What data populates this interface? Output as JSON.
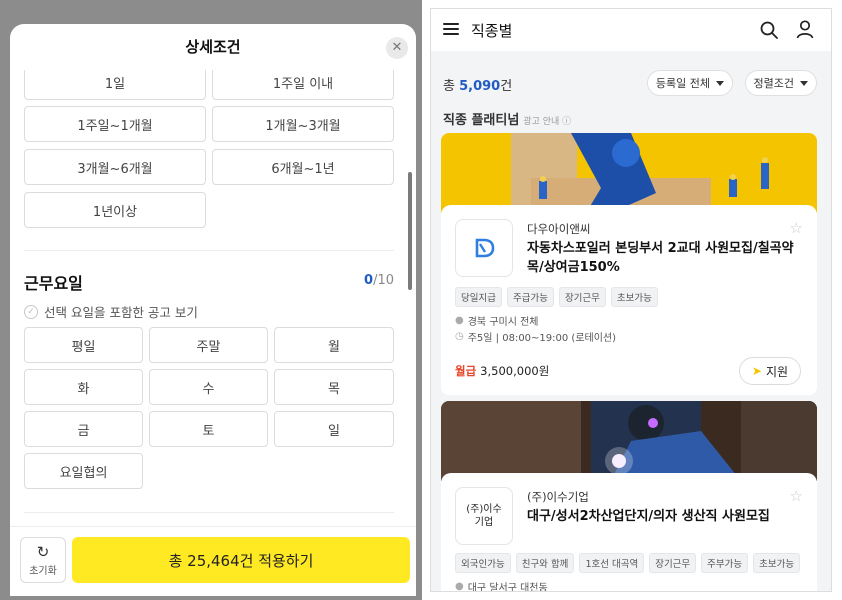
{
  "left": {
    "title": "상세조건",
    "close_icon": "close-icon",
    "period_options": [
      "1일",
      "1주일 이내",
      "1주일~1개월",
      "1개월~3개월",
      "3개월~6개월",
      "6개월~1년",
      "1년이상"
    ],
    "workday": {
      "title": "근무요일",
      "count_current": "0",
      "count_total": "/10",
      "check_label": "선택 요일을 포함한 공고 보기",
      "options": [
        "평일",
        "주말",
        "월",
        "화",
        "수",
        "목",
        "금",
        "토",
        "일",
        "요일협의"
      ]
    },
    "reset_label": "초기화",
    "apply_label": "총 25,464건 적용하기"
  },
  "right": {
    "header_title": "직종별",
    "total_prefix": "총 ",
    "total_count": "5,090",
    "total_suffix": "건",
    "filter_date": "등록일 전체",
    "filter_sort": "정렬조건",
    "section_label": "직종 플래티넘",
    "ad_label": "광고 안내 ⓘ",
    "cards": [
      {
        "company": "다우아이앤씨",
        "title": "자동차스포일러 본딩부서 2교대 사원모집/칠곡약목/상여금150%",
        "tags": [
          "당일지급",
          "주급가능",
          "장기근무",
          "초보가능"
        ],
        "location": "경북 구미시 전체",
        "schedule": "주5일 | 08:00~19:00 (로테이션)",
        "salary_label": "월급",
        "salary": "3,500,000원",
        "apply_label": "지원"
      },
      {
        "company": "(주)이수기업",
        "logo_text": "(주)이수기업",
        "title": "대구/성서2차산업단지/의자 생산직 사원모집",
        "tags": [
          "외국인가능",
          "친구와 함께",
          "1호선 대곡역",
          "장기근무",
          "주부가능",
          "초보가능"
        ],
        "location": "대구 달서구 대천동"
      }
    ]
  }
}
